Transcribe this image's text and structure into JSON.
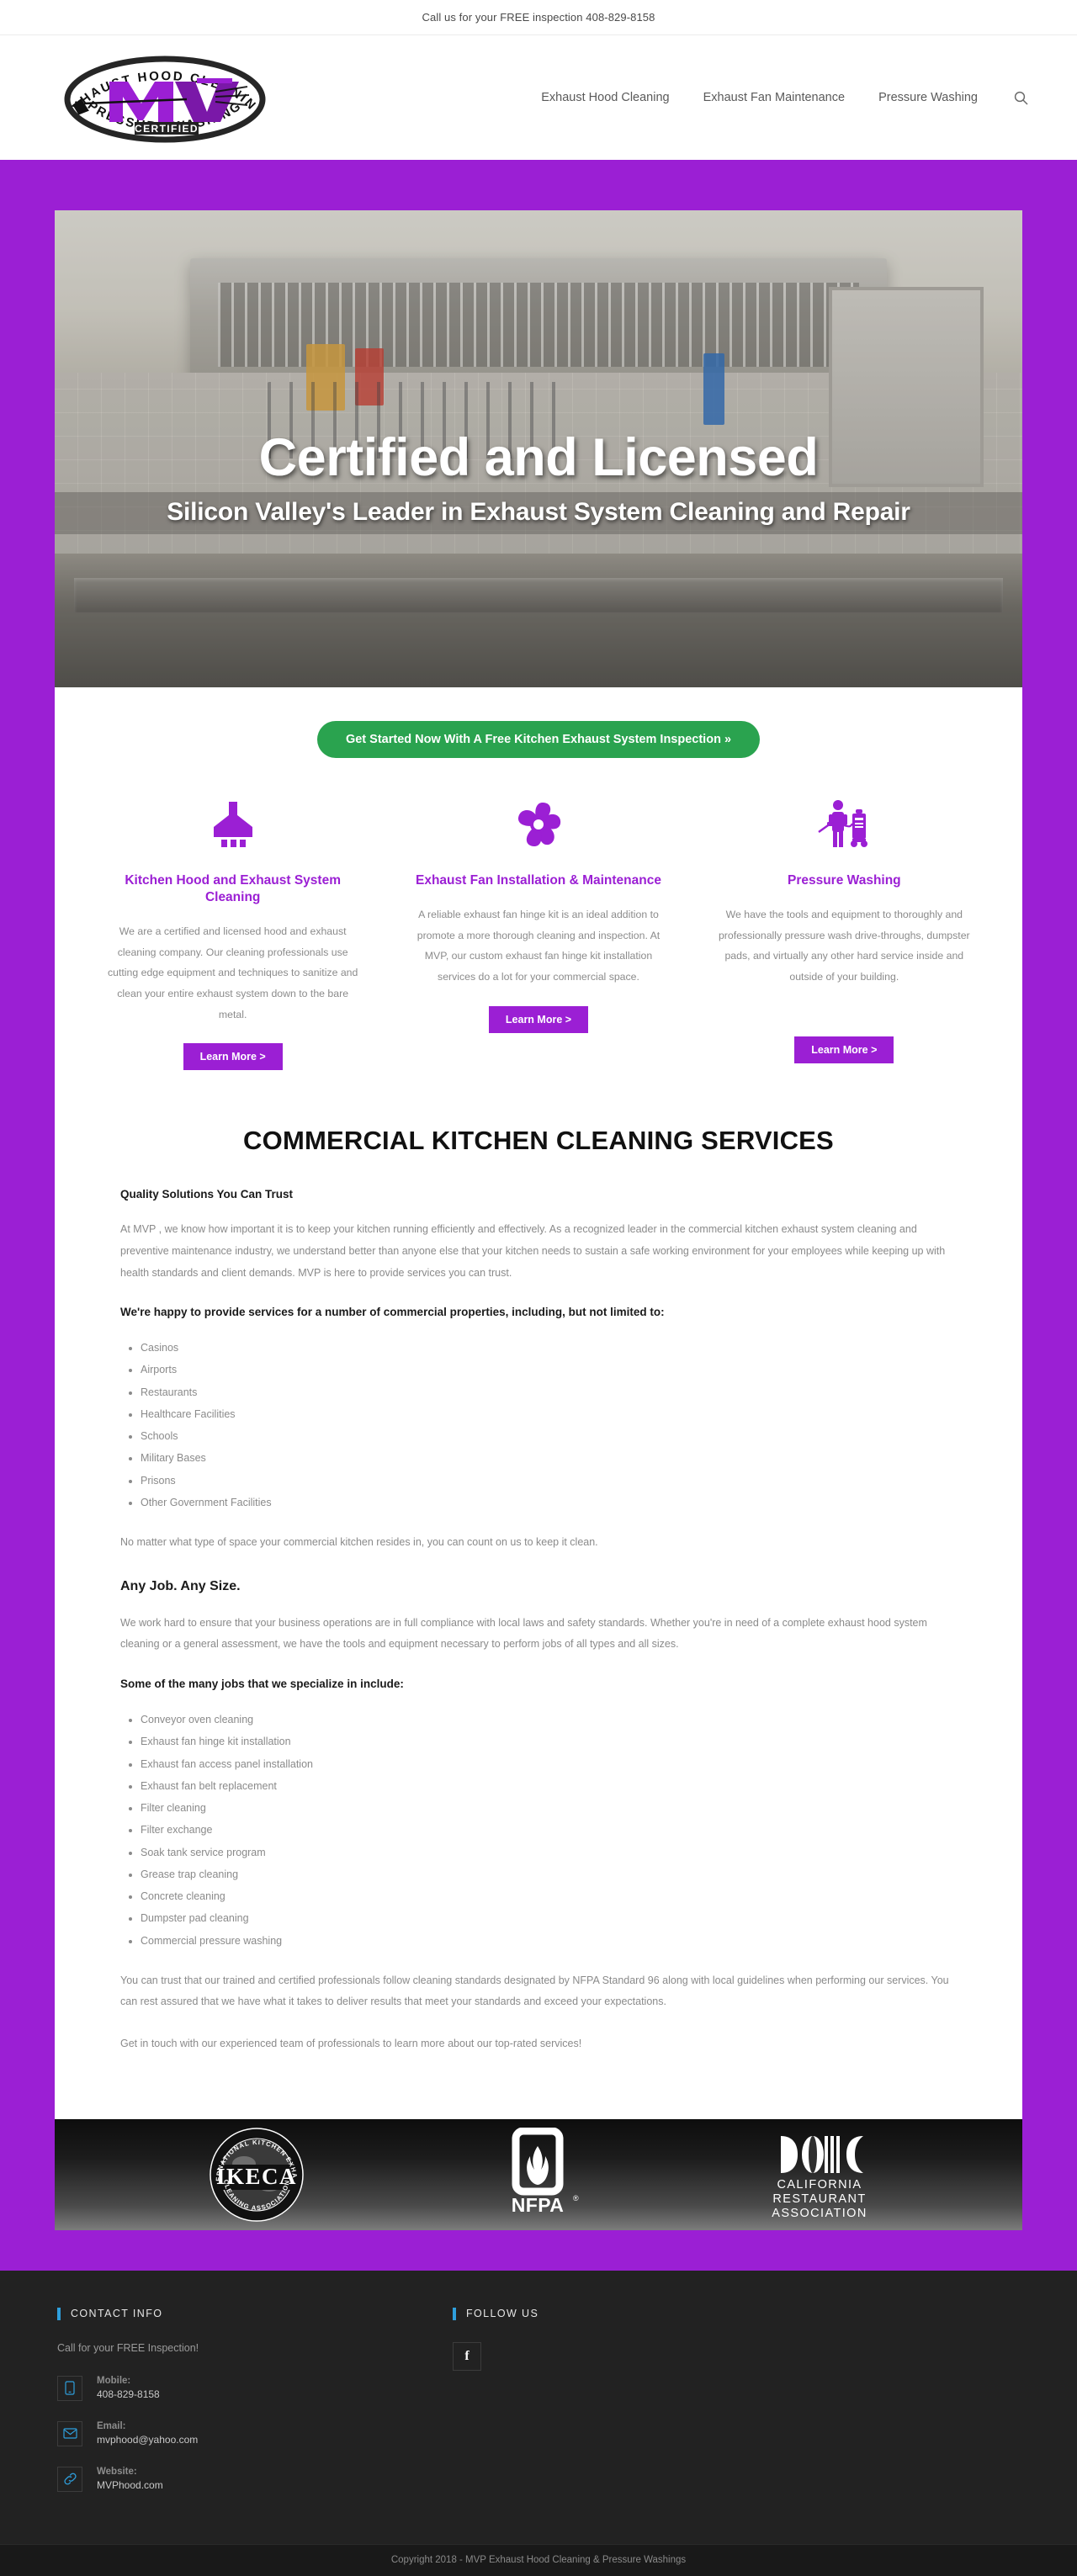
{
  "topbar": {
    "text": "Call us for your FREE inspection 408-829-8158"
  },
  "header": {
    "logo": {
      "top_arc": "EXHAUST HOOD CLEANING",
      "mark": "MVP",
      "badge": "CERTIFIED",
      "bottom_arc": "PRESSURE WASHING"
    },
    "nav": [
      {
        "label": "Exhaust Hood Cleaning"
      },
      {
        "label": "Exhaust Fan Maintenance"
      },
      {
        "label": "Pressure Washing"
      }
    ],
    "search_icon": "search-icon"
  },
  "hero": {
    "title": "Certified and Licensed",
    "subtitle": "Silicon Valley's Leader in Exhaust System Cleaning and Repair"
  },
  "cta": {
    "label": "Get Started Now With A Free Kitchen Exhaust System Inspection »"
  },
  "cards": [
    {
      "icon": "range-hood-icon",
      "title": "Kitchen Hood and Exhaust System Cleaning",
      "body": "We are a certified and licensed hood and exhaust cleaning company. Our cleaning professionals use cutting edge equipment and techniques to sanitize and clean your entire exhaust system down to the bare metal.",
      "button": "Learn More >"
    },
    {
      "icon": "exhaust-fan-icon",
      "title": "Exhaust Fan Installation & Maintenance",
      "body": "A reliable exhaust fan hinge kit is an ideal addition to promote a more thorough cleaning and inspection. At MVP, our custom exhaust fan hinge kit installation services do a lot for your commercial space.",
      "button": "Learn More >"
    },
    {
      "icon": "pressure-washer-person-icon",
      "title": "Pressure Washing",
      "body": "We have the tools and equipment to thoroughly and professionally pressure wash drive-throughs, dumpster pads, and virtually any other hard service inside and outside of your building.",
      "button": "Learn More >"
    }
  ],
  "article": {
    "heading": "COMMERCIAL KITCHEN CLEANING SERVICES",
    "sub1": "Quality Solutions You Can Trust",
    "p1": "At MVP , we know how important it is to keep your kitchen running efficiently and effectively. As a recognized leader in the commercial kitchen exhaust system cleaning and preventive maintenance industry, we understand better than anyone else that your kitchen needs to sustain a safe working environment for your employees while keeping up with health standards and client demands. MVP is here to provide services you can trust.",
    "sub2": "We're happy to provide services for a number of commercial properties, including, but not limited to:",
    "list1": [
      "Casinos",
      "Airports",
      "Restaurants",
      "Healthcare Facilities",
      "Schools",
      "Military Bases",
      "Prisons",
      "Other Government Facilities"
    ],
    "p2": "No matter what type of space your commercial kitchen resides in, you can count on us to keep it clean.",
    "sub3": "Any Job. Any Size.",
    "p3": "We work hard to ensure that your business operations are in full compliance with local laws and safety standards. Whether you're in need of a complete exhaust hood system cleaning or a general assessment, we have the tools and equipment necessary to perform jobs of all types and all sizes.",
    "sub4": "Some of the many jobs that we specialize in include:",
    "list2": [
      "Conveyor oven cleaning",
      "Exhaust fan hinge kit installation",
      "Exhaust fan access panel installation",
      "Exhaust fan belt replacement",
      "Filter cleaning",
      "Filter exchange",
      "Soak tank service program",
      "Grease trap cleaning",
      "Concrete cleaning",
      "Dumpster pad cleaning",
      "Commercial pressure washing"
    ],
    "p4": "You can trust that our trained and certified professionals follow cleaning standards designated by NFPA Standard 96 along with local guidelines when performing our services. You can rest assured that we have what it takes to deliver results that meet your standards and exceed your expectations.",
    "p5": "Get in touch with our experienced team of professionals to learn more about our top-rated services!"
  },
  "certifications": [
    {
      "icon": "ikeca-logo",
      "name": "IKECA",
      "outer_top": "INTERNATIONAL KITCHEN EXHAUST",
      "outer_bottom": "CLEANING ASSOCIATION"
    },
    {
      "icon": "nfpa-logo",
      "name": "NFPA"
    },
    {
      "icon": "california-restaurant-association-logo",
      "line1": "CALIFORNIA",
      "line2": "RESTAURANT",
      "line3": "ASSOCIATION"
    }
  ],
  "footer": {
    "contact_heading": "CONTACT INFO",
    "follow_heading": "FOLLOW US",
    "tagline": "Call for your FREE Inspection!",
    "rows": [
      {
        "icon": "mobile-icon",
        "label": "Mobile:",
        "value": "408-829-8158"
      },
      {
        "icon": "email-icon",
        "label": "Email:",
        "value": "mvphood@yahoo.com"
      },
      {
        "icon": "link-icon",
        "label": "Website:",
        "value": "MVPhood.com"
      }
    ],
    "social": [
      {
        "icon": "facebook-icon",
        "glyph": "f"
      }
    ],
    "copyright": "Copyright 2018 - MVP Exhaust Hood Cleaning & Pressure Washings"
  },
  "colors": {
    "brand_purple": "#9B1FD4",
    "cta_green": "#2aa34f",
    "accent_blue": "#2e9fdd",
    "footer_dark": "#222222"
  }
}
